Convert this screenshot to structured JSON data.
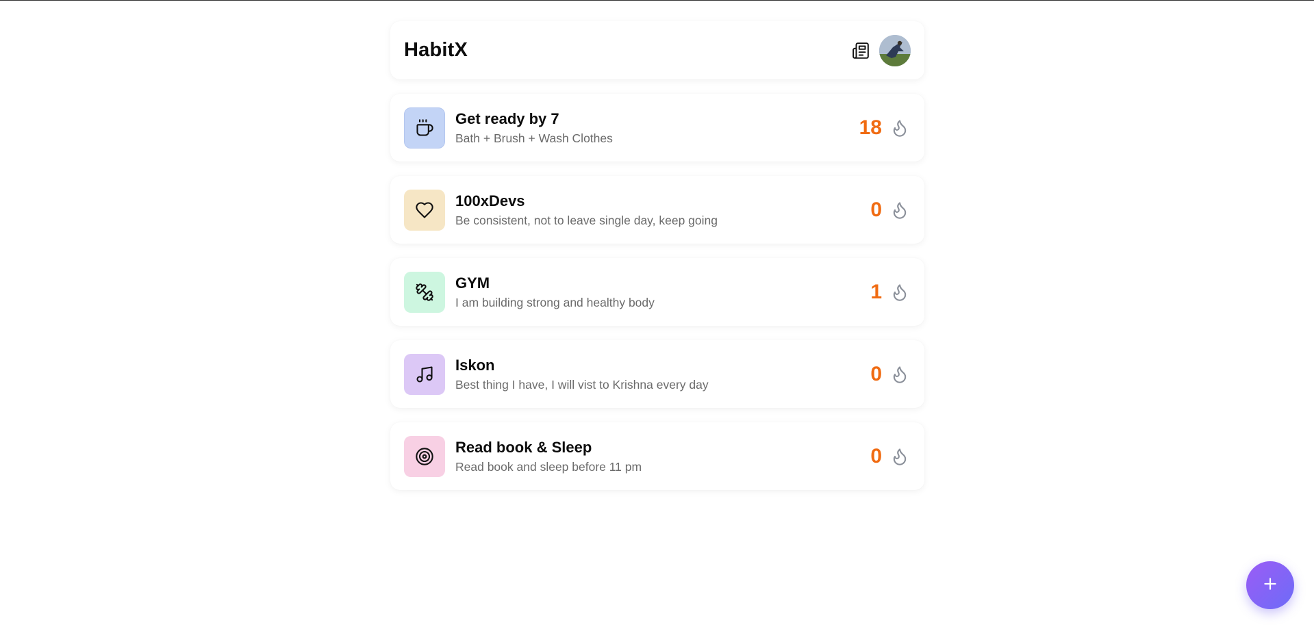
{
  "header": {
    "app_title": "HabitX",
    "news_icon": "newspaper-icon",
    "avatar_icon": "user-avatar"
  },
  "habits": [
    {
      "title": "Get ready by 7",
      "description": "Bath + Brush + Wash Clothes",
      "streak": "18",
      "icon": "coffee-cup-icon",
      "icon_bg": "#c3d4f6"
    },
    {
      "title": "100xDevs",
      "description": "Be consistent, not to leave single day, keep going",
      "streak": "0",
      "icon": "heart-icon",
      "icon_bg": "#f6e6c5"
    },
    {
      "title": "GYM",
      "description": "I am building strong and healthy body",
      "streak": "1",
      "icon": "dumbbell-icon",
      "icon_bg": "#cdf6e0"
    },
    {
      "title": "Iskon",
      "description": "Best thing I have, I will vist to Krishna every day",
      "streak": "0",
      "icon": "music-note-icon",
      "icon_bg": "#dcc8f6"
    },
    {
      "title": "Read book & Sleep",
      "description": "Read book and sleep before 11 pm",
      "streak": "0",
      "icon": "target-icon",
      "icon_bg": "#f8d0e4"
    }
  ],
  "fab": {
    "icon": "plus-icon"
  },
  "colors": {
    "streak": "#f06b12",
    "flame": "#8a8f99",
    "fab_start": "#9b5cf6",
    "fab_end": "#6d6cf7"
  }
}
